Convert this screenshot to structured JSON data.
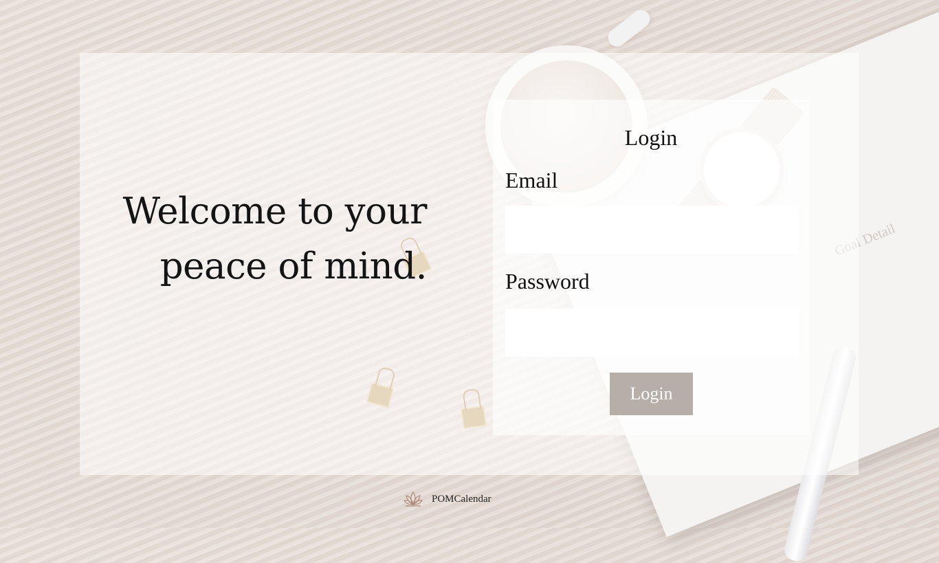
{
  "hero": {
    "headline": "Welcome to your peace of mind."
  },
  "login": {
    "title": "Login",
    "email_label": "Email",
    "email_value": "",
    "password_label": "Password",
    "password_value": "",
    "button_label": "Login"
  },
  "footer": {
    "brand_name": "POMCalendar",
    "logo_icon": "lotus-icon"
  },
  "background": {
    "notebook_title": "Goal Detail"
  },
  "colors": {
    "button_bg": "#b6aea8",
    "button_text": "#ffffff",
    "logo": "#b08a7a"
  }
}
